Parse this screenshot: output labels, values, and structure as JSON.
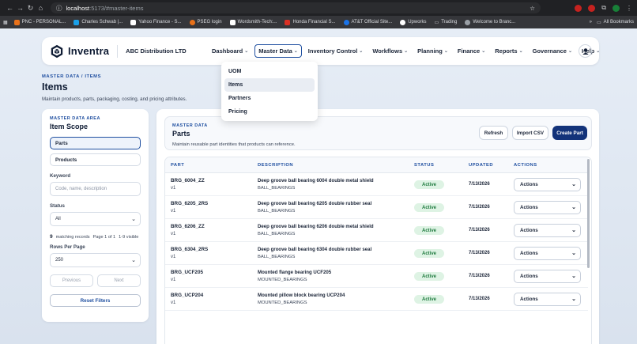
{
  "browser": {
    "url_host": "localhost",
    "url_path": ":5173/#master-items",
    "bookmarks": [
      {
        "label": "PNC - PERSONAL...",
        "color": "#e8711a"
      },
      {
        "label": "Charles Schwab |...",
        "color": "#1aa0e8"
      },
      {
        "label": "Yahoo Finance - S...",
        "color": "#ffffff"
      },
      {
        "label": "PSEG login",
        "color": "#e8711a"
      },
      {
        "label": "Wordsmith-Tech:...",
        "color": "#ffffff"
      },
      {
        "label": "Honda Financial S...",
        "color": "#d93025"
      },
      {
        "label": "AT&T Official Site...",
        "color": "#1a73e8"
      },
      {
        "label": "Upworks",
        "color": "#ffffff"
      },
      {
        "label": "Trading",
        "color": "#9aa0a6"
      },
      {
        "label": "Welcome to Branc...",
        "color": "#9aa0a6"
      }
    ],
    "more": "»",
    "all_bookmarks": "All Bookmarks"
  },
  "header": {
    "logo_text": "Inventra",
    "company": "ABC Distribution LTD",
    "nav": [
      {
        "label": "Dashboard"
      },
      {
        "label": "Master Data"
      },
      {
        "label": "Inventory Control"
      },
      {
        "label": "Workflows"
      },
      {
        "label": "Planning"
      },
      {
        "label": "Finance"
      },
      {
        "label": "Reports"
      },
      {
        "label": "Governance"
      },
      {
        "label": "Help"
      }
    ]
  },
  "dropdown": [
    "UOM",
    "Items",
    "Partners",
    "Pricing"
  ],
  "page": {
    "breadcrumb": "MASTER DATA / ITEMS",
    "title": "Items",
    "subtitle": "Maintain products, parts, packaging, costing, and pricing attributes."
  },
  "scope": {
    "eyebrow": "MASTER DATA AREA",
    "title": "Item Scope",
    "options": [
      "Parts",
      "Products"
    ],
    "keyword_label": "Keyword",
    "keyword_placeholder": "Code, name, description",
    "status_label": "Status",
    "status_value": "All",
    "count": "9",
    "count_text": "matching records",
    "page_info": "Page 1 of 1",
    "range": "1-9 visible",
    "rows_label": "Rows Per Page",
    "rows_value": "250",
    "prev": "Previous",
    "next": "Next",
    "reset": "Reset Filters"
  },
  "main": {
    "eyebrow": "MASTER DATA",
    "title": "Parts",
    "subtitle": "Maintain reusable part identities that products can reference.",
    "refresh": "Refresh",
    "import": "Import CSV",
    "create": "Create Part",
    "columns": [
      "PART",
      "DESCRIPTION",
      "STATUS",
      "UPDATED",
      "ACTIONS"
    ],
    "rows": [
      {
        "part": "BRG_6004_ZZ",
        "ver": "v1",
        "desc": "Deep groove ball bearing 6004 double metal shield",
        "cat": "BALL_BEARINGS",
        "status": "Active",
        "updated": "7/13/2026",
        "action": "Actions"
      },
      {
        "part": "BRG_6205_2RS",
        "ver": "v1",
        "desc": "Deep groove ball bearing 6205 double rubber seal",
        "cat": "BALL_BEARINGS",
        "status": "Active",
        "updated": "7/13/2026",
        "action": "Actions"
      },
      {
        "part": "BRG_6206_ZZ",
        "ver": "v1",
        "desc": "Deep groove ball bearing 6206 double metal shield",
        "cat": "BALL_BEARINGS",
        "status": "Active",
        "updated": "7/13/2026",
        "action": "Actions"
      },
      {
        "part": "BRG_6304_2RS",
        "ver": "v1",
        "desc": "Deep groove ball bearing 6304 double rubber seal",
        "cat": "BALL_BEARINGS",
        "status": "Active",
        "updated": "7/13/2026",
        "action": "Actions"
      },
      {
        "part": "BRG_UCF205",
        "ver": "v1",
        "desc": "Mounted flange bearing UCF205",
        "cat": "MOUNTED_BEARINGS",
        "status": "Active",
        "updated": "7/13/2026",
        "action": "Actions"
      },
      {
        "part": "BRG_UCP204",
        "ver": "v1",
        "desc": "Mounted pillow block bearing UCP204",
        "cat": "MOUNTED_BEARINGS",
        "status": "Active",
        "updated": "7/13/2026",
        "action": "Actions"
      }
    ]
  }
}
